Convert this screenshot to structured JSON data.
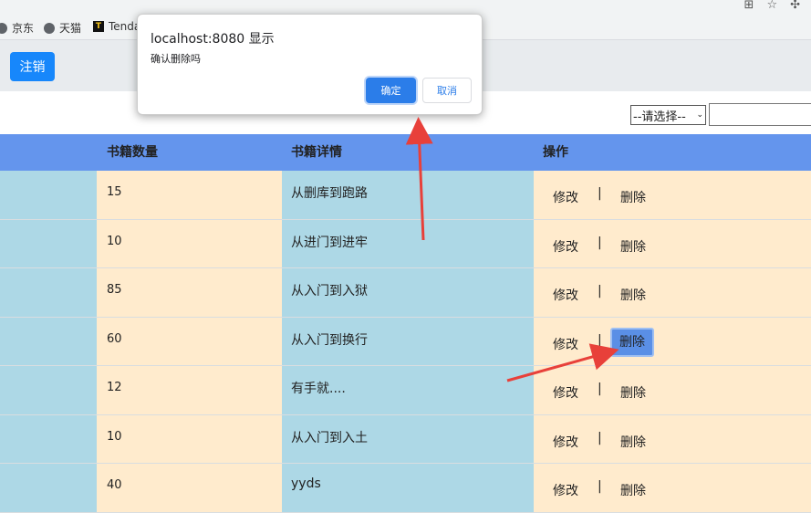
{
  "browser": {
    "bookmarks": [
      {
        "label": "京东",
        "icon": "globe-icon"
      },
      {
        "label": "天猫",
        "icon": "globe-icon"
      },
      {
        "label": "Tenda",
        "icon": "tenda-icon"
      }
    ],
    "top_icons": [
      "translate-icon",
      "star-icon",
      "extensions-icon"
    ]
  },
  "header": {
    "logout_label": "注销"
  },
  "filter": {
    "select_value": "--请选择--",
    "search_value": ""
  },
  "table": {
    "headers": {
      "count": "书籍数量",
      "detail": "书籍详情",
      "ops": "操作"
    },
    "edit_label": "修改",
    "separator": "|",
    "delete_label": "删除",
    "rows": [
      {
        "count": "15",
        "detail": "从删库到跑路"
      },
      {
        "count": "10",
        "detail": "从进门到进牢"
      },
      {
        "count": "85",
        "detail": "从入门到入狱"
      },
      {
        "count": "60",
        "detail": "从入门到换行"
      },
      {
        "count": "12",
        "detail": "有手就...."
      },
      {
        "count": "10",
        "detail": "从入门到入土"
      },
      {
        "count": "40",
        "detail": "yyds"
      }
    ]
  },
  "dialog": {
    "title": "localhost:8080 显示",
    "message": "确认删除吗",
    "ok_label": "确定",
    "cancel_label": "取消"
  },
  "colors": {
    "header_row": "#6495ed",
    "cell_blue": "#add8e6",
    "cell_peach": "#ffebcd",
    "primary": "#1787fb",
    "arrow": "#e8403a"
  }
}
